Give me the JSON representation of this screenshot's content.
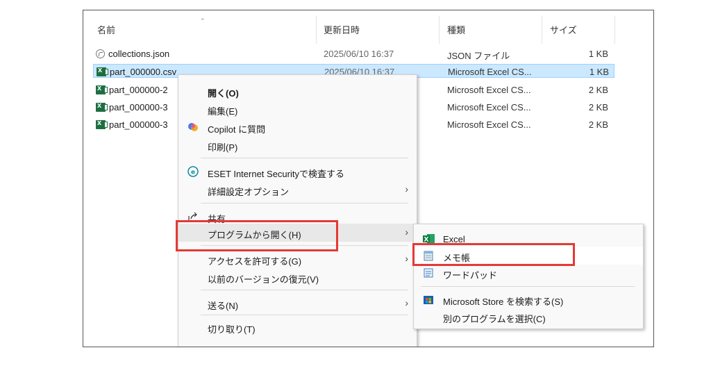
{
  "columns": {
    "name": "名前",
    "date": "更新日時",
    "type": "種類",
    "size": "サイズ"
  },
  "files": [
    {
      "name": "collections.json",
      "date": "2025/06/10 16:37",
      "type": "JSON ファイル",
      "size": "1 KB",
      "icon": "json-file-icon"
    },
    {
      "name": "part_000000.csv",
      "date": "2025/06/10 16:37",
      "type": "Microsoft Excel CS...",
      "size": "1 KB",
      "icon": "excel-csv-icon"
    },
    {
      "name": "part_000000-2",
      "date": "",
      "type": "Microsoft Excel CS...",
      "size": "2 KB",
      "icon": "excel-csv-icon"
    },
    {
      "name": "part_000000-3",
      "date": "",
      "type": "Microsoft Excel CS...",
      "size": "2 KB",
      "icon": "excel-csv-icon"
    },
    {
      "name": "part_000000-3",
      "date": "",
      "type": "Microsoft Excel CS...",
      "size": "2 KB",
      "icon": "excel-csv-icon"
    }
  ],
  "context_menu": {
    "open": "開く(O)",
    "edit": "編集(E)",
    "copilot": "Copilot に質問",
    "print": "印刷(P)",
    "eset": "ESET Internet Securityで検査する",
    "advanced": "詳細設定オプション",
    "share": "共有",
    "open_with": "プログラムから開く(H)",
    "give_access": "アクセスを許可する(G)",
    "restore": "以前のバージョンの復元(V)",
    "send_to": "送る(N)",
    "cut": "切り取り(T)"
  },
  "submenu": {
    "excel": "Excel",
    "notepad": "メモ帳",
    "wordpad": "ワードパッド",
    "store": "Microsoft Store を検索する(S)",
    "choose": "別のプログラムを選択(C)"
  },
  "colors": {
    "highlight": "#e53935",
    "selection": "#cce8ff",
    "excel": "#1d6f42"
  }
}
